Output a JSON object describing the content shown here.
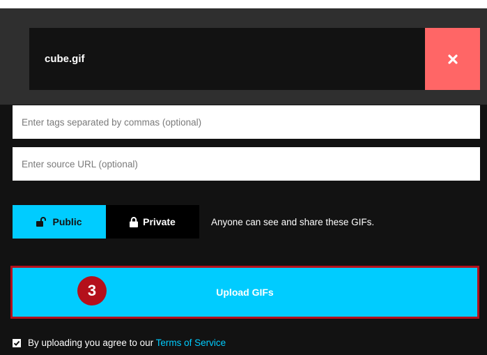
{
  "file": {
    "name": "cube.gif",
    "remove_icon": "close-icon"
  },
  "tags_input": {
    "value": "",
    "placeholder": "Enter tags separated by commas (optional)"
  },
  "source_input": {
    "value": "",
    "placeholder": "Enter source URL (optional)"
  },
  "visibility": {
    "public_label": "Public",
    "public_icon": "unlock-icon",
    "private_label": "Private",
    "private_icon": "lock-icon",
    "selected": "Public",
    "description": "Anyone can see and share these GIFs."
  },
  "upload": {
    "label": "Upload GIFs",
    "step_badge": "3"
  },
  "agreement": {
    "checked": true,
    "text": "By uploading you agree to our",
    "link_text": "Terms of Service"
  },
  "colors": {
    "accent": "#00ccff",
    "remove": "#ff6666",
    "badge": "#b4101b",
    "panel": "#121212",
    "file_area": "#2f2f2f"
  }
}
